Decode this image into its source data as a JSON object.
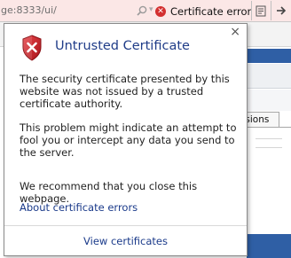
{
  "address_bar": {
    "url": "ge:8333/ui/",
    "cert_error_label": "Certificate error",
    "icons": [
      "search-icon",
      "cert-error-icon",
      "compat-view-icon",
      "go-arrow-icon"
    ]
  },
  "background": {
    "tab_label": "issions"
  },
  "popup": {
    "title": "Untrusted Certificate",
    "close": "×",
    "paragraph1": "The security certificate presented by this website was not issued by a trusted certificate authority.",
    "paragraph2": "This problem might indicate an attempt to fool you or intercept any data you send to the server.",
    "paragraph3": "We recommend that you close this webpage.",
    "about_link": "About certificate errors",
    "view_certificates": "View certificates",
    "icon": "shield-error-icon"
  },
  "colors": {
    "address_bar_bg": "#fbe7e6",
    "title": "#1f3c88",
    "link": "#1a3a8a",
    "error_red": "#d32f2f",
    "page_blue": "#2f5fa5"
  }
}
